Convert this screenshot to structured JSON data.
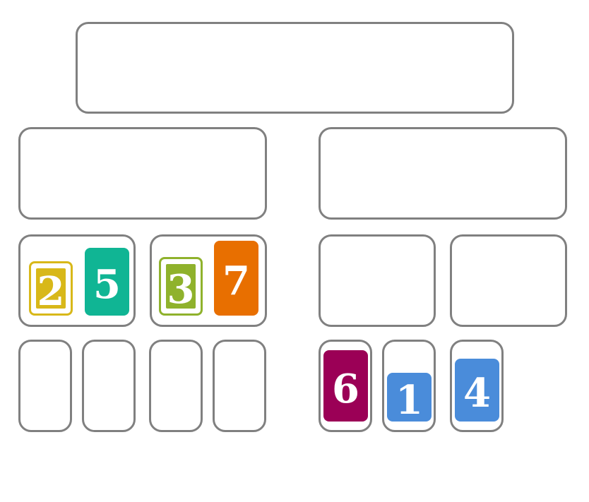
{
  "colors": {
    "slot_border": "#808080",
    "yellow": "#D8B819",
    "teal": "#10B594",
    "green": "#8FB22C",
    "orange": "#E86F00",
    "magenta": "#9B0056",
    "blue": "#4A8CDA"
  },
  "cards": {
    "c2": {
      "value": "2",
      "color": "yellow",
      "style": "outlined"
    },
    "c5": {
      "value": "5",
      "color": "teal",
      "style": "solid"
    },
    "c3": {
      "value": "3",
      "color": "green",
      "style": "outlined"
    },
    "c7": {
      "value": "7",
      "color": "orange",
      "style": "solid"
    },
    "c6": {
      "value": "6",
      "color": "magenta",
      "style": "solid"
    },
    "c1": {
      "value": "1",
      "color": "blue",
      "style": "solid"
    },
    "c4": {
      "value": "4",
      "color": "blue",
      "style": "solid"
    }
  }
}
